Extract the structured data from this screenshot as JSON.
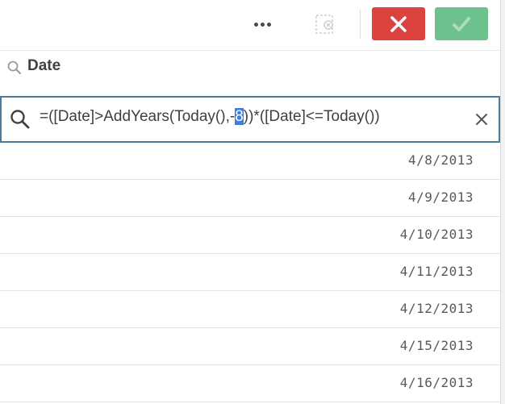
{
  "toolbar": {
    "more_icon": "ellipsis-icon",
    "clear_icon": "clear-selections-icon",
    "cancel_icon": "close-icon",
    "confirm_icon": "check-icon",
    "cancel_color": "#dc423e",
    "confirm_color": "#6cc18f"
  },
  "field": {
    "title": "Date",
    "icon": "search-icon"
  },
  "search": {
    "expression_prefix": "=([Date]>AddYears(Today(),-",
    "expression_selected": "8",
    "expression_suffix": "))*([Date]<=Today())",
    "border_color": "#4a7b9d",
    "icon": "search-icon",
    "clear_icon": "close-icon"
  },
  "values": {
    "items": [
      "4/8/2013",
      "4/9/2013",
      "4/10/2013",
      "4/11/2013",
      "4/12/2013",
      "4/15/2013",
      "4/16/2013"
    ]
  }
}
